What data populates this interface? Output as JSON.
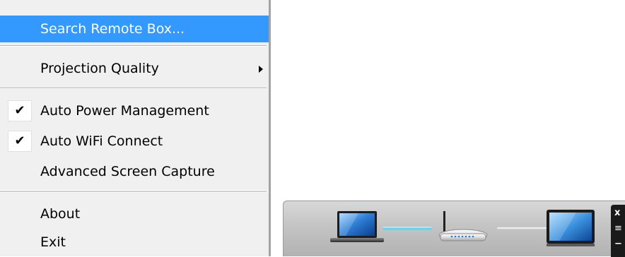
{
  "menu": {
    "items": [
      {
        "label": "Search Remote Box...",
        "highlighted": true
      },
      {
        "label": "Projection Quality",
        "has_submenu": true
      },
      {
        "label": "Auto Power Management",
        "checked": true
      },
      {
        "label": "Auto WiFi Connect",
        "checked": true
      },
      {
        "label": "Advanced Screen Capture",
        "checked": false
      },
      {
        "label": "About"
      },
      {
        "label": "Exit"
      }
    ],
    "highlight_color": "#3399ff",
    "check_glyph": "✔"
  },
  "status_bar": {
    "connection_left": "active",
    "connection_right": "idle",
    "devices": [
      "laptop-icon",
      "router-icon",
      "monitor-icon"
    ],
    "side_buttons": [
      "close-icon",
      "menu-icon",
      "minimize-icon"
    ],
    "close_glyph": "x",
    "menu_glyph": "≡",
    "minimize_glyph": "−",
    "accent_color": "#3fc6e0"
  }
}
